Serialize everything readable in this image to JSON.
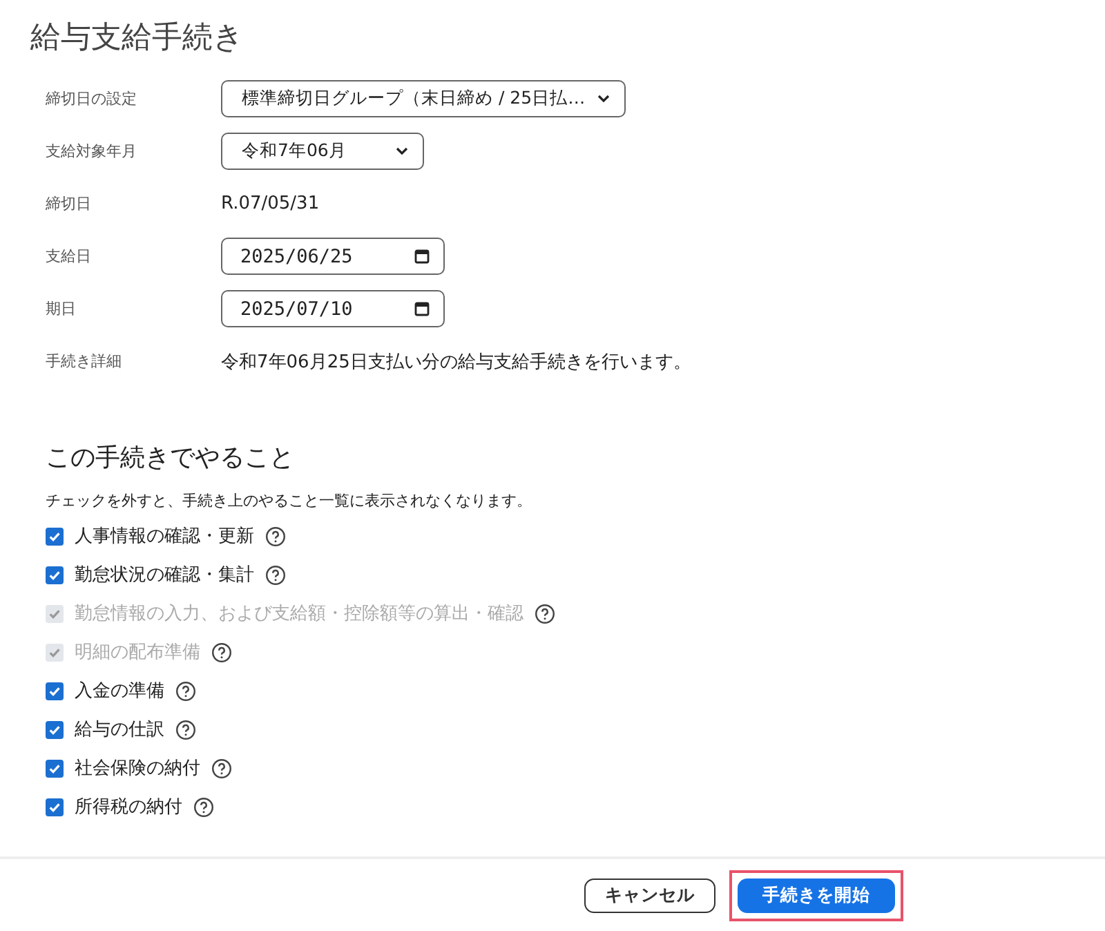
{
  "title": "給与支給手続き",
  "fields": [
    {
      "label": "締切日の設定",
      "kind": "select",
      "value": "標準締切日グループ（末日締め / 25日払…"
    },
    {
      "label": "支給対象年月",
      "kind": "select",
      "value": "令和7年06月"
    },
    {
      "label": "締切日",
      "kind": "text",
      "value": "R.07/05/31"
    },
    {
      "label": "支給日",
      "kind": "date",
      "value": "2025/06/25"
    },
    {
      "label": "期日",
      "kind": "date",
      "value": "2025/07/10"
    },
    {
      "label": "手続き詳細",
      "kind": "text",
      "value": "令和7年06月25日支払い分の給与支給手続きを行います。"
    }
  ],
  "section": {
    "heading": "この手続きでやること",
    "note": "チェックを外すと、手続き上のやること一覧に表示されなくなります。"
  },
  "tasks": [
    {
      "label": "人事情報の確認・更新",
      "checked": true,
      "disabled": false
    },
    {
      "label": "勤怠状況の確認・集計",
      "checked": true,
      "disabled": false
    },
    {
      "label": "勤怠情報の入力、および支給額・控除額等の算出・確認",
      "checked": true,
      "disabled": true
    },
    {
      "label": "明細の配布準備",
      "checked": true,
      "disabled": true
    },
    {
      "label": "入金の準備",
      "checked": true,
      "disabled": false
    },
    {
      "label": "給与の仕訳",
      "checked": true,
      "disabled": false
    },
    {
      "label": "社会保険の納付",
      "checked": true,
      "disabled": false
    },
    {
      "label": "所得税の納付",
      "checked": true,
      "disabled": false
    }
  ],
  "footer": {
    "buttons": [
      {
        "label": "キャンセル",
        "kind": "secondary",
        "highlighted": false
      },
      {
        "label": "手続きを開始",
        "kind": "primary",
        "highlighted": true
      }
    ]
  }
}
